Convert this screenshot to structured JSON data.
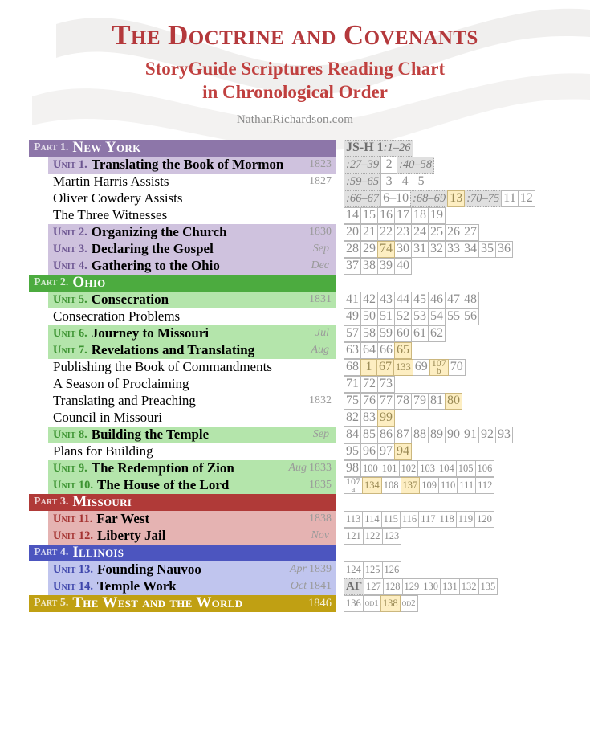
{
  "header": {
    "title": "The Doctrine and Covenants",
    "subtitle_line1": "StoryGuide Scriptures Reading Chart",
    "subtitle_line2": "in Chronological Order",
    "byline": "NathanRichardson.com"
  },
  "colors": {
    "title_red": "#b4393c",
    "part1_purple": "#8d76a9",
    "unit1_purple": "#cfc2de",
    "part2_green": "#4cab3f",
    "unit2_green": "#b4e5ab",
    "part3_red": "#b03a38",
    "unit3_red": "#e5b3b2",
    "part4_blue": "#4c55bf",
    "unit4_blue": "#c0c5ee",
    "part5_gold": "#c0a013",
    "highlight_tan": "#fdeec2",
    "cell_gray": "#e0e0e0"
  },
  "rows": [
    {
      "type": "part",
      "style": "p1",
      "kicker": "Part 1.",
      "name": "New York",
      "date": "",
      "cells": [
        {
          "t": "JS-H 1",
          "sub": ":1–26",
          "k": "jsh-head"
        }
      ]
    },
    {
      "type": "unit",
      "style": "u1",
      "kicker": "Unit 1.",
      "name": "Translating the Book of Mormon",
      "date": "1823",
      "cells": [
        {
          "t": ":27–39",
          "k": "jsh"
        },
        {
          "t": "2"
        },
        {
          "t": ":40–58",
          "k": "jsh"
        }
      ]
    },
    {
      "type": "sub",
      "style": "sub",
      "kicker": "",
      "name": "Martin Harris Assists",
      "date": "1827",
      "cells": [
        {
          "t": ":59–65",
          "k": "jsh"
        },
        {
          "t": "3"
        },
        {
          "t": "4"
        },
        {
          "t": "5"
        }
      ]
    },
    {
      "type": "sub",
      "style": "sub",
      "kicker": "",
      "name": "Oliver Cowdery Assists",
      "date": "",
      "cells": [
        {
          "t": ":66–67",
          "k": "jsh"
        },
        {
          "t": "6–10"
        },
        {
          "t": ":68–69",
          "k": "jsh"
        },
        {
          "t": "13",
          "k": "hl"
        },
        {
          "t": ":70–75",
          "k": "jsh"
        },
        {
          "t": "11"
        },
        {
          "t": "12"
        }
      ]
    },
    {
      "type": "sub",
      "style": "sub",
      "kicker": "",
      "name": "The Three Witnesses",
      "date": "",
      "cells": [
        {
          "t": "14"
        },
        {
          "t": "15"
        },
        {
          "t": "16"
        },
        {
          "t": "17"
        },
        {
          "t": "18"
        },
        {
          "t": "19"
        }
      ]
    },
    {
      "type": "unit",
      "style": "u1",
      "kicker": "Unit 2.",
      "name": "Organizing the Church",
      "date": "1830",
      "cells": [
        {
          "t": "20"
        },
        {
          "t": "21"
        },
        {
          "t": "22"
        },
        {
          "t": "23"
        },
        {
          "t": "24"
        },
        {
          "t": "25"
        },
        {
          "t": "26"
        },
        {
          "t": "27"
        }
      ]
    },
    {
      "type": "unit",
      "style": "u1",
      "kicker": "Unit 3.",
      "name": "Declaring the Gospel",
      "month": "Sep",
      "date": "",
      "cells": [
        {
          "t": "28"
        },
        {
          "t": "29"
        },
        {
          "t": "74",
          "k": "hl"
        },
        {
          "t": "30"
        },
        {
          "t": "31"
        },
        {
          "t": "32"
        },
        {
          "t": "33"
        },
        {
          "t": "34"
        },
        {
          "t": "35"
        },
        {
          "t": "36"
        }
      ]
    },
    {
      "type": "unit",
      "style": "u1",
      "kicker": "Unit 4.",
      "name": "Gathering to the Ohio",
      "month": "Dec",
      "date": "",
      "cells": [
        {
          "t": "37"
        },
        {
          "t": "38"
        },
        {
          "t": "39"
        },
        {
          "t": "40"
        }
      ]
    },
    {
      "type": "part",
      "style": "p2",
      "kicker": "Part 2.",
      "name": "Ohio",
      "date": "",
      "cells": []
    },
    {
      "type": "unit",
      "style": "u2",
      "kicker": "Unit 5.",
      "name": "Consecration",
      "date": "1831",
      "cells": [
        {
          "t": "41"
        },
        {
          "t": "42"
        },
        {
          "t": "43"
        },
        {
          "t": "44"
        },
        {
          "t": "45"
        },
        {
          "t": "46"
        },
        {
          "t": "47"
        },
        {
          "t": "48"
        }
      ]
    },
    {
      "type": "sub",
      "style": "sub",
      "kicker": "",
      "name": "Consecration Problems",
      "date": "",
      "cells": [
        {
          "t": "49"
        },
        {
          "t": "50"
        },
        {
          "t": "51"
        },
        {
          "t": "52"
        },
        {
          "t": "53"
        },
        {
          "t": "54"
        },
        {
          "t": "55"
        },
        {
          "t": "56"
        }
      ]
    },
    {
      "type": "unit",
      "style": "u2",
      "kicker": "Unit 6.",
      "name": "Journey to Missouri",
      "month": "Jul",
      "date": "",
      "cells": [
        {
          "t": "57"
        },
        {
          "t": "58"
        },
        {
          "t": "59"
        },
        {
          "t": "60"
        },
        {
          "t": "61"
        },
        {
          "t": "62"
        }
      ]
    },
    {
      "type": "unit",
      "style": "u2",
      "kicker": "Unit 7.",
      "name": "Revelations and Translating",
      "month": "Aug",
      "date": "",
      "cells": [
        {
          "t": "63"
        },
        {
          "t": "64"
        },
        {
          "t": "66"
        },
        {
          "t": "65",
          "k": "hl"
        }
      ]
    },
    {
      "type": "sub",
      "style": "sub",
      "kicker": "",
      "name": "Publishing the Book of Commandments",
      "date": "",
      "cells": [
        {
          "t": "68"
        },
        {
          "t": "1",
          "k": "hl"
        },
        {
          "t": "67",
          "k": "hl"
        },
        {
          "t": "133",
          "k": "hl small"
        },
        {
          "t": "69"
        },
        {
          "t": "107",
          "b": "b",
          "k": "hl stack"
        },
        {
          "t": "70"
        }
      ]
    },
    {
      "type": "sub",
      "style": "sub",
      "kicker": "",
      "name": "A Season of Proclaiming",
      "date": "",
      "cells": [
        {
          "t": "71"
        },
        {
          "t": "72"
        },
        {
          "t": "73"
        }
      ]
    },
    {
      "type": "sub",
      "style": "sub",
      "kicker": "",
      "name": "Translating and Preaching",
      "date": "1832",
      "cells": [
        {
          "t": "75"
        },
        {
          "t": "76"
        },
        {
          "t": "77"
        },
        {
          "t": "78"
        },
        {
          "t": "79"
        },
        {
          "t": "81"
        },
        {
          "t": "80",
          "k": "hl"
        }
      ]
    },
    {
      "type": "sub",
      "style": "sub",
      "kicker": "",
      "name": "Council in Missouri",
      "date": "",
      "cells": [
        {
          "t": "82"
        },
        {
          "t": "83"
        },
        {
          "t": "99",
          "k": "hl"
        }
      ]
    },
    {
      "type": "unit",
      "style": "u2",
      "kicker": "Unit 8.",
      "name": "Building the Temple",
      "month": "Sep",
      "date": "",
      "cells": [
        {
          "t": "84"
        },
        {
          "t": "85"
        },
        {
          "t": "86"
        },
        {
          "t": "87"
        },
        {
          "t": "88"
        },
        {
          "t": "89"
        },
        {
          "t": "90"
        },
        {
          "t": "91"
        },
        {
          "t": "92"
        },
        {
          "t": "93"
        }
      ]
    },
    {
      "type": "sub",
      "style": "sub",
      "kicker": "",
      "name": "Plans for Building",
      "date": "",
      "cells": [
        {
          "t": "95"
        },
        {
          "t": "96"
        },
        {
          "t": "97"
        },
        {
          "t": "94",
          "k": "hl"
        }
      ]
    },
    {
      "type": "unit",
      "style": "u2",
      "kicker": "Unit 9.",
      "name": "The Redemption of Zion",
      "month": "Aug",
      "date": "1833",
      "cells": [
        {
          "t": "98"
        },
        {
          "t": "100",
          "k": "small"
        },
        {
          "t": "101",
          "k": "small"
        },
        {
          "t": "102",
          "k": "small"
        },
        {
          "t": "103",
          "k": "small"
        },
        {
          "t": "104",
          "k": "small"
        },
        {
          "t": "105",
          "k": "small"
        },
        {
          "t": "106",
          "k": "small"
        }
      ]
    },
    {
      "type": "unit",
      "style": "u2",
      "kicker": "Unit 10.",
      "name": "The House of the Lord",
      "date": "1835",
      "cells": [
        {
          "t": "107",
          "b": "a",
          "k": "stack"
        },
        {
          "t": "134",
          "k": "hl small"
        },
        {
          "t": "108",
          "k": "small"
        },
        {
          "t": "137",
          "k": "hl small"
        },
        {
          "t": "109",
          "k": "small"
        },
        {
          "t": "110",
          "k": "small"
        },
        {
          "t": "111",
          "k": "small"
        },
        {
          "t": "112",
          "k": "small"
        }
      ]
    },
    {
      "type": "part",
      "style": "p3",
      "kicker": "Part 3.",
      "name": "Missouri",
      "date": "",
      "cells": []
    },
    {
      "type": "unit",
      "style": "u3",
      "kicker": "Unit 11.",
      "name": "Far West",
      "date": "1838",
      "cells": [
        {
          "t": "113",
          "k": "small"
        },
        {
          "t": "114",
          "k": "small"
        },
        {
          "t": "115",
          "k": "small"
        },
        {
          "t": "116",
          "k": "small"
        },
        {
          "t": "117",
          "k": "small"
        },
        {
          "t": "118",
          "k": "small"
        },
        {
          "t": "119",
          "k": "small"
        },
        {
          "t": "120",
          "k": "small"
        }
      ]
    },
    {
      "type": "unit",
      "style": "u3",
      "kicker": "Unit 12.",
      "name": "Liberty Jail",
      "month": "Nov",
      "date": "",
      "cells": [
        {
          "t": "121",
          "k": "small"
        },
        {
          "t": "122",
          "k": "small"
        },
        {
          "t": "123",
          "k": "small"
        }
      ]
    },
    {
      "type": "part",
      "style": "p4",
      "kicker": "Part 4.",
      "name": "Illinois",
      "date": "",
      "cells": []
    },
    {
      "type": "unit",
      "style": "u4",
      "kicker": "Unit 13.",
      "name": "Founding Nauvoo",
      "month": "Apr",
      "date": "1839",
      "cells": [
        {
          "t": "124",
          "k": "small"
        },
        {
          "t": "125",
          "k": "small"
        },
        {
          "t": "126",
          "k": "small"
        }
      ]
    },
    {
      "type": "unit",
      "style": "u4",
      "kicker": "Unit 14.",
      "name": "Temple Work",
      "month": "Oct",
      "date": "1841",
      "cells": [
        {
          "t": "AF",
          "k": "af"
        },
        {
          "t": "127",
          "k": "small"
        },
        {
          "t": "128",
          "k": "small"
        },
        {
          "t": "129",
          "k": "small"
        },
        {
          "t": "130",
          "k": "small"
        },
        {
          "t": "131",
          "k": "small"
        },
        {
          "t": "132",
          "k": "small"
        },
        {
          "t": "135",
          "k": "small"
        }
      ]
    },
    {
      "type": "part",
      "style": "p5",
      "kicker": "Part 5.",
      "name": "The West and the World",
      "date": "1846",
      "cells": [
        {
          "t": "136",
          "k": "small"
        },
        {
          "t": "od1",
          "k": "od"
        },
        {
          "t": "138",
          "k": "hl small"
        },
        {
          "t": "od2",
          "k": "od"
        }
      ]
    }
  ]
}
